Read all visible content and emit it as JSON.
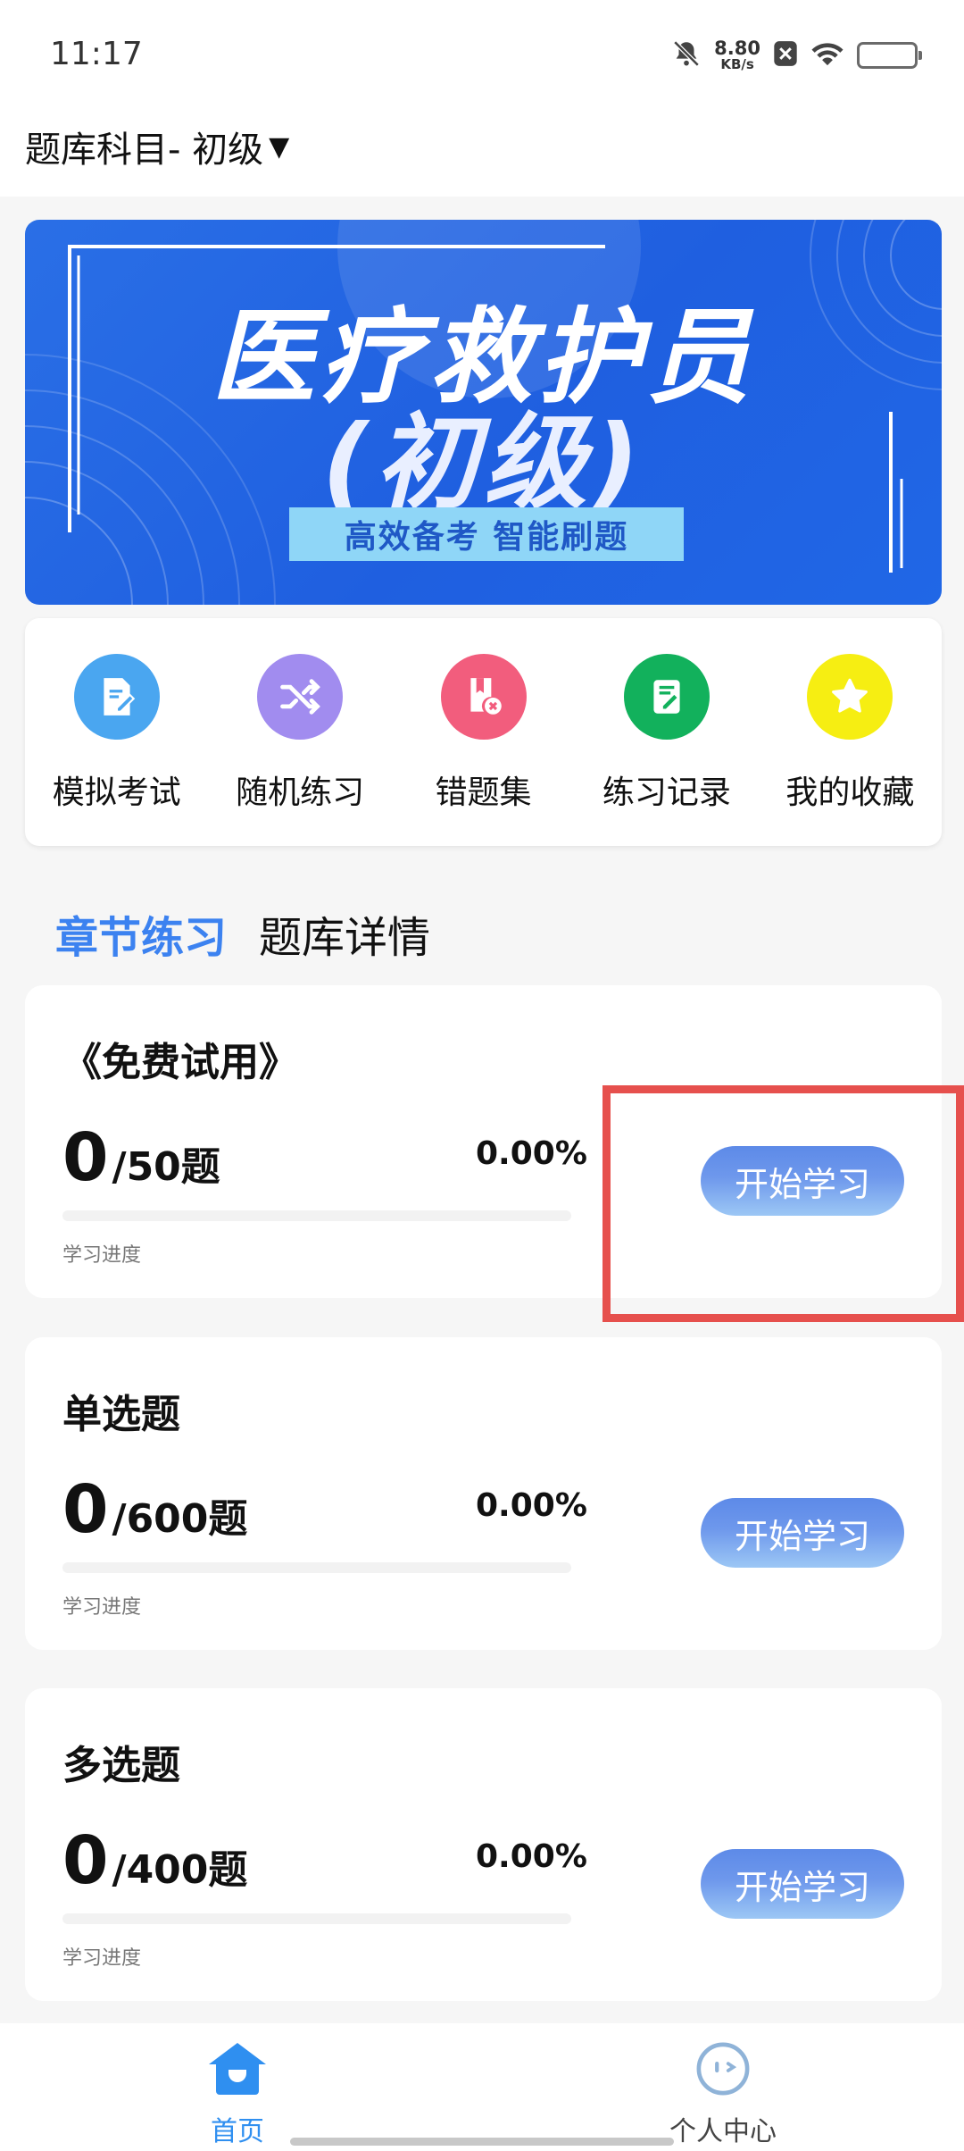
{
  "status_bar": {
    "time": "11:17",
    "net_speed": "8.80",
    "net_unit": "KB/s",
    "icons": [
      "bell-off-icon",
      "close-box-icon",
      "wifi-icon",
      "battery-icon"
    ]
  },
  "header": {
    "subject": "题库科目- 初级",
    "dropdown_icon": "caret-down-icon"
  },
  "banner": {
    "title_line1": "医疗救护员",
    "title_line2": "(初级)",
    "tagline": "高效备考  智能刷题",
    "colors": {
      "bg": "#1f5fe0",
      "tag_bg": "#8fd6f7"
    }
  },
  "quick_actions": [
    {
      "label": "模拟考试",
      "icon": "exam-doc-icon",
      "color": "#4aa6f0"
    },
    {
      "label": "随机练习",
      "icon": "shuffle-icon",
      "color": "#a18cef"
    },
    {
      "label": "错题集",
      "icon": "wrong-book-icon",
      "color": "#f25d7d"
    },
    {
      "label": "练习记录",
      "icon": "record-icon",
      "color": "#12b15c"
    },
    {
      "label": "我的收藏",
      "icon": "star-icon",
      "color": "#f6ee12"
    }
  ],
  "tabs": [
    {
      "label": "章节练习",
      "active": true
    },
    {
      "label": "题库详情",
      "active": false
    }
  ],
  "sections": [
    {
      "title": "《免费试用》",
      "done": "0",
      "total": "/50题",
      "percent": "0.00%",
      "progress": 0,
      "progress_label": "学习进度",
      "button": "开始学习"
    },
    {
      "title": "单选题",
      "done": "0",
      "total": "/600题",
      "percent": "0.00%",
      "progress": 0,
      "progress_label": "学习进度",
      "button": "开始学习"
    },
    {
      "title": "多选题",
      "done": "0",
      "total": "/400题",
      "percent": "0.00%",
      "progress": 0,
      "progress_label": "学习进度",
      "button": "开始学习"
    }
  ],
  "bottom_nav": [
    {
      "label": "首页",
      "icon": "home-icon",
      "active": true
    },
    {
      "label": "个人中心",
      "icon": "profile-face-icon",
      "active": false
    }
  ],
  "colors": {
    "accent": "#3c82f0",
    "highlight": "#e6504d"
  }
}
